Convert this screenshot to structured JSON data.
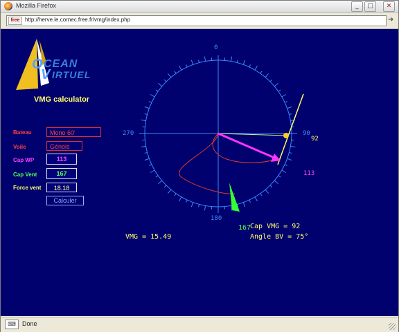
{
  "window": {
    "title": "Mozilla Firefox",
    "minimize": "_",
    "maximize": "□",
    "close": "✕"
  },
  "address": {
    "favicon_text": "free",
    "url": "http://herve.le.cornec.free.fr/vmg/index.php",
    "go_icon": "arrow-right-icon"
  },
  "logo": {
    "line1": "CEAN",
    "line2": "IRTUEL"
  },
  "heading": "VMG calculator",
  "form": {
    "bateau_label": "Bateau",
    "bateau_value": "Mono 60'",
    "voile_label": "Voile",
    "voile_value": "Génois",
    "capwp_label": "Cap WP",
    "capwp_value": "113",
    "capvent_label": "Cap Vent",
    "capvent_value": "167",
    "force_label": "Force vent",
    "force_value": "18.18",
    "button": "Calculer"
  },
  "dial": {
    "n": "0",
    "e": "90",
    "s": "180",
    "w": "270",
    "heading_label": "92",
    "wp_label": "113",
    "wind_label": "167"
  },
  "results": {
    "vmg": "VMG = 15.49",
    "cap_vmg": "Cap VMG = 92",
    "angle_bv": "Angle BV = 75°"
  },
  "colors": {
    "background": "#00006e",
    "heading_arrow": "#ffff66",
    "wp_arrow": "#ff33ff",
    "wind_arrow": "#33ff33",
    "polar": "#e03a2a",
    "ticks": "#3a8aff"
  },
  "status": {
    "text": "Done"
  }
}
